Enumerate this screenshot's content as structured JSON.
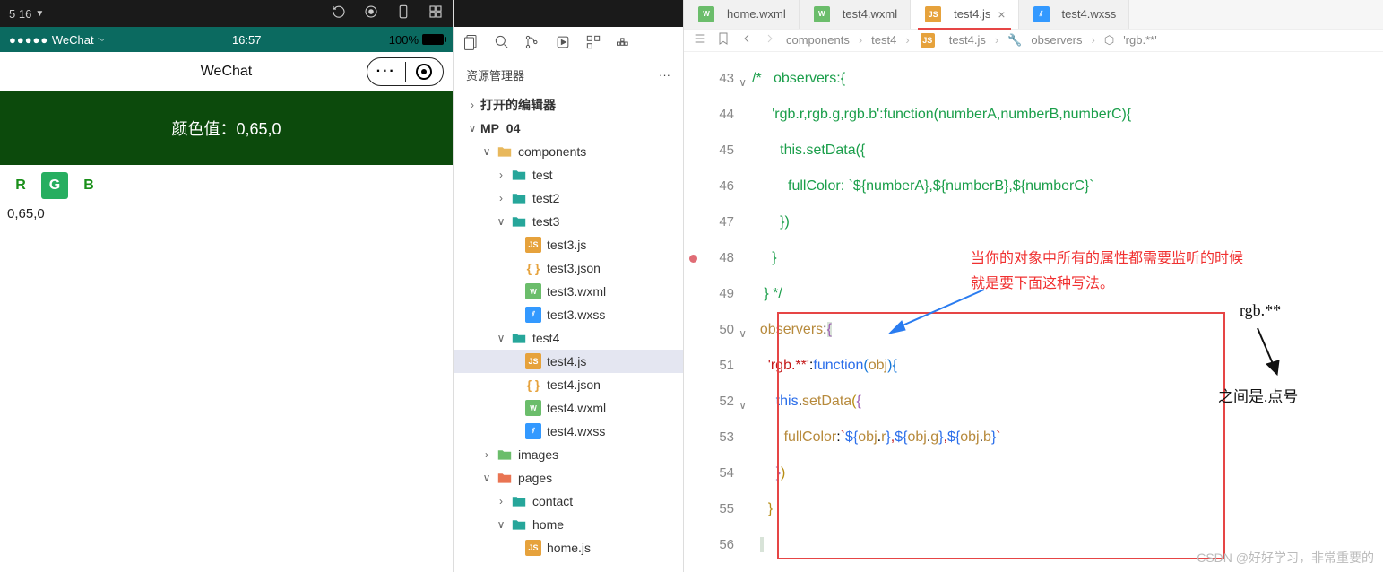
{
  "sim": {
    "device_label": "5 16",
    "status_carrier": "WeChat",
    "status_time": "16:57",
    "status_battery": "100%",
    "nav_title": "WeChat",
    "color_label": "颜色值：0,65,0",
    "btn_r": "R",
    "btn_g": "G",
    "btn_b": "B",
    "rgb_value": "0,65,0"
  },
  "explorer": {
    "title": "资源管理器",
    "open_editors": "打开的编辑器",
    "project": "MP_04",
    "items": {
      "components": "components",
      "test": "test",
      "test2": "test2",
      "test3": "test3",
      "test3_js": "test3.js",
      "test3_json": "test3.json",
      "test3_wxml": "test3.wxml",
      "test3_wxss": "test3.wxss",
      "test4": "test4",
      "test4_js": "test4.js",
      "test4_json": "test4.json",
      "test4_wxml": "test4.wxml",
      "test4_wxss": "test4.wxss",
      "images": "images",
      "pages": "pages",
      "contact": "contact",
      "home": "home",
      "home_js": "home.js"
    }
  },
  "tabs": {
    "home_wxml": "home.wxml",
    "test4_wxml": "test4.wxml",
    "test4_js": "test4.js",
    "test4_wxss": "test4.wxss"
  },
  "breadcrumb": {
    "p1": "components",
    "p2": "test4",
    "p3": "test4.js",
    "p4": "observers",
    "p5": "'rgb.**'"
  },
  "code": {
    "line_start": 43,
    "lines": [
      "/*   observers:{",
      "     'rgb.r,rgb.g,rgb.b':function(numberA,numberB,numberC){",
      "       this.setData({",
      "         fullColor: `${numberA},${numberB},${numberC}`",
      "       })",
      "     }",
      "   } */",
      "  observers:{",
      "    'rgb.**':function(obj){",
      "      this.setData({",
      "        fullColor:`${obj.r},${obj.g},${obj.b}`",
      "      })",
      "    }",
      ""
    ]
  },
  "annotations": {
    "comment_line1": "当你的对象中所有的属性都需要监听的时候",
    "comment_line2": "就是要下面这种写法。",
    "right_label1": "rgb.**",
    "right_label2": "之间是.点号"
  },
  "watermark": "CSDN @好好学习，非常重要的"
}
